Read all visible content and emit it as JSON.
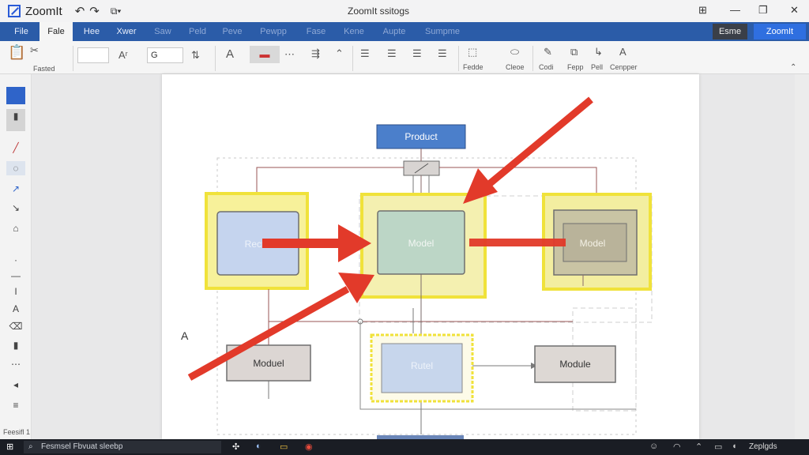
{
  "app": {
    "name": "ZoomIt",
    "doc_title": "ZoomIt ssitogs"
  },
  "window": {
    "undo": "↶",
    "redo": "↷",
    "clip": "⧉▾",
    "ctrl_icons": "⊞   —   ❐   ✕"
  },
  "ribbon": {
    "tabs": [
      "File",
      "Fale",
      "Hee",
      "Xwer",
      "Saw",
      "Peld",
      "Peve",
      "Pewpp",
      "Fase",
      "Kene",
      "Aupte",
      "Sumpme"
    ],
    "active_tab": "Fale",
    "right_buttons": [
      "Esme",
      "ZoomIt"
    ]
  },
  "toolbar": {
    "paste_label": "Fasted",
    "font_value": "",
    "font_size_label": "Aʳ",
    "size_value": "G",
    "groups": [
      "Fedde",
      "Cleoe",
      "Codi",
      "Fepp",
      "Pell",
      "Cenpper"
    ]
  },
  "diagram": {
    "box_product": "Product",
    "box_rect_left": "Rect",
    "box_model_center": "Model",
    "box_model_right": "Model",
    "box_moduel_left": "Moduel",
    "box_rutel": "Rutel",
    "box_module_right": "Module",
    "label_a": "A"
  },
  "leftpanel": {
    "footer": "Feesifl 1"
  },
  "taskbar": {
    "search_text": "Fesmsel Fbvuat sleebp",
    "tray_text": "Zeplgds"
  },
  "colors": {
    "accent_blue": "#2b5ca8",
    "annotation_red": "#e23a2a",
    "highlight_yellow": "#f2e94a"
  }
}
